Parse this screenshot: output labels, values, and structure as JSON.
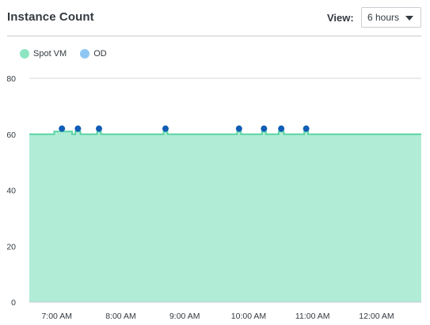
{
  "header": {
    "title": "Instance Count",
    "view_label": "View:",
    "view_value": "6 hours"
  },
  "colors": {
    "spot_fill": "#b1ecd6",
    "spot_line": "#5bd4a4",
    "od_swatch": "#8ec7f3",
    "od_point": "#0f5db4"
  },
  "legend": [
    {
      "name": "Spot VM",
      "color": "#8ce5c0"
    },
    {
      "name": "OD",
      "color": "#8ec7f3"
    }
  ],
  "chart_data": {
    "type": "area",
    "ylim": [
      0,
      80
    ],
    "y_ticks": [
      0,
      20,
      40,
      60,
      80
    ],
    "x_ticks": [
      "7:00 AM",
      "8:00 AM",
      "9:00 AM",
      "10:00 AM",
      "11:00 AM",
      "12:00 AM"
    ],
    "xlim_hours": [
      6.57,
      12.7
    ],
    "grid": true,
    "legend_position": "top-left",
    "series": [
      {
        "name": "Spot VM",
        "type": "area",
        "points": [
          [
            6.57,
            60
          ],
          [
            6.96,
            60
          ],
          [
            6.96,
            61
          ],
          [
            7.24,
            61
          ],
          [
            7.24,
            60
          ],
          [
            7.29,
            60
          ],
          [
            7.29,
            61
          ],
          [
            7.37,
            61
          ],
          [
            7.37,
            60
          ],
          [
            7.63,
            60
          ],
          [
            7.63,
            61
          ],
          [
            7.69,
            61
          ],
          [
            7.69,
            60
          ],
          [
            8.67,
            60
          ],
          [
            8.67,
            61
          ],
          [
            8.73,
            61
          ],
          [
            8.73,
            60
          ],
          [
            9.82,
            60
          ],
          [
            9.82,
            61
          ],
          [
            9.88,
            61
          ],
          [
            9.88,
            60
          ],
          [
            10.21,
            60
          ],
          [
            10.21,
            61
          ],
          [
            10.27,
            61
          ],
          [
            10.27,
            60
          ],
          [
            10.47,
            60
          ],
          [
            10.47,
            61
          ],
          [
            10.55,
            61
          ],
          [
            10.55,
            60
          ],
          [
            10.87,
            60
          ],
          [
            10.87,
            61
          ],
          [
            10.93,
            61
          ],
          [
            10.93,
            60
          ],
          [
            12.7,
            60
          ]
        ]
      },
      {
        "name": "OD",
        "type": "scatter",
        "x": [
          7.08,
          7.33,
          7.66,
          8.7,
          9.85,
          10.24,
          10.51,
          10.9
        ],
        "y": [
          62,
          62,
          62,
          62,
          62,
          62,
          62,
          62
        ]
      }
    ]
  }
}
